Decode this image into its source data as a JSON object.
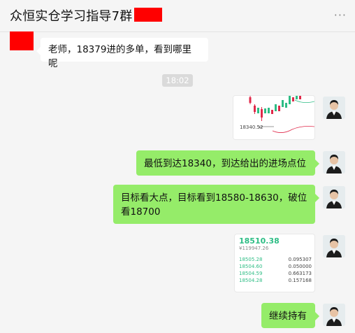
{
  "header": {
    "title": "众恒实仓学习指导7群",
    "more_icon": "more-dots-icon"
  },
  "messages": {
    "m1": {
      "text": "老师，18379进的多单，看到哪里呢"
    },
    "time": "18:02",
    "m2": {
      "type": "chart-image",
      "price_label": "18340.52",
      "arrow": "←"
    },
    "m3": {
      "text": "最低到达18340，到达给出的进场点位"
    },
    "m4": {
      "line1": "目标看大点，目标看到18580-18630，破位",
      "line2": "看18700"
    },
    "m5": {
      "type": "quote-image",
      "price": "18510.38",
      "sub": "¥119947.26",
      "rows": [
        {
          "price": "18505.28",
          "qty": "0.095307"
        },
        {
          "price": "18504.60",
          "qty": "0.050000"
        },
        {
          "price": "18504.59",
          "qty": "0.663173"
        },
        {
          "price": "18504.28",
          "qty": "0.157168"
        }
      ]
    },
    "m6": {
      "text": "继续持有"
    }
  },
  "colors": {
    "bubble_out": "#95ec69",
    "bubble_in": "#ffffff",
    "redact": "#ff0000",
    "up": "#2ebd85",
    "down": "#e0294a"
  }
}
